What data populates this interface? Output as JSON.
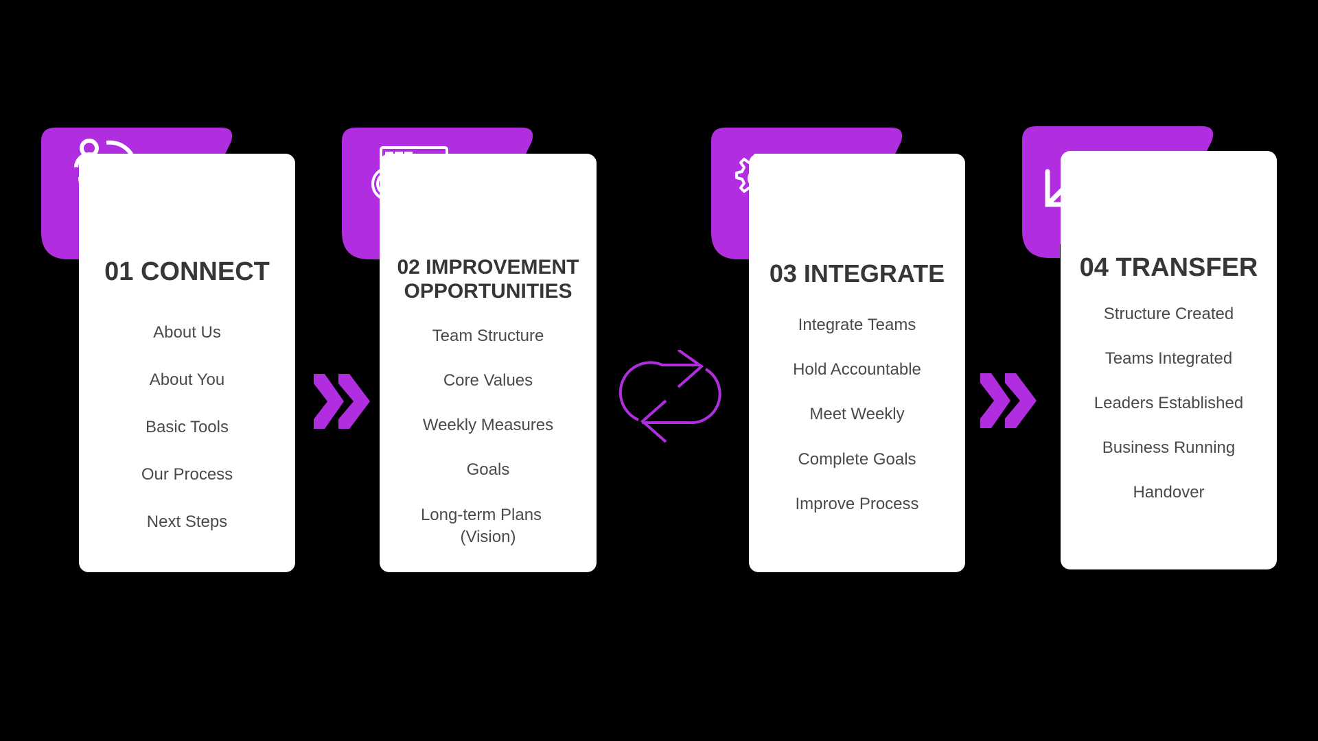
{
  "colors": {
    "background": "#000000",
    "accent": "#b02ee0",
    "card": "#ffffff",
    "title_text": "#363636",
    "item_text": "#4a4a4a"
  },
  "steps": [
    {
      "title": "01 CONNECT",
      "icon": "people-cycle-icon",
      "items": [
        "About Us",
        "About You",
        "Basic Tools",
        "Our Process",
        "Next Steps"
      ]
    },
    {
      "title_line1": "02 IMPROVEMENT",
      "title_line2": "OPPORTUNITIES",
      "icon": "analytics-magnifier-icon",
      "items": [
        "Team Structure",
        "Core Values",
        "Weekly Measures",
        "Goals",
        "Long-term Plans",
        "(Vision)"
      ]
    },
    {
      "title": "03 INTEGRATE",
      "icon": "gears-arrow-icon",
      "items": [
        "Integrate Teams",
        "Hold Accountable",
        "Meet Weekly",
        "Complete Goals",
        "Improve Process"
      ]
    },
    {
      "title": "04 TRANSFER",
      "icon": "diagonal-arrows-icon",
      "items": [
        "Structure Created",
        "Teams Integrated",
        "Leaders Established",
        "Business Running",
        "Handover"
      ]
    }
  ],
  "connectors": [
    {
      "between": "01-02",
      "icon": "double-chevron-right-icon"
    },
    {
      "between": "02-03",
      "icon": "repeat-cycle-icon"
    },
    {
      "between": "03-04",
      "icon": "double-chevron-right-icon"
    }
  ]
}
